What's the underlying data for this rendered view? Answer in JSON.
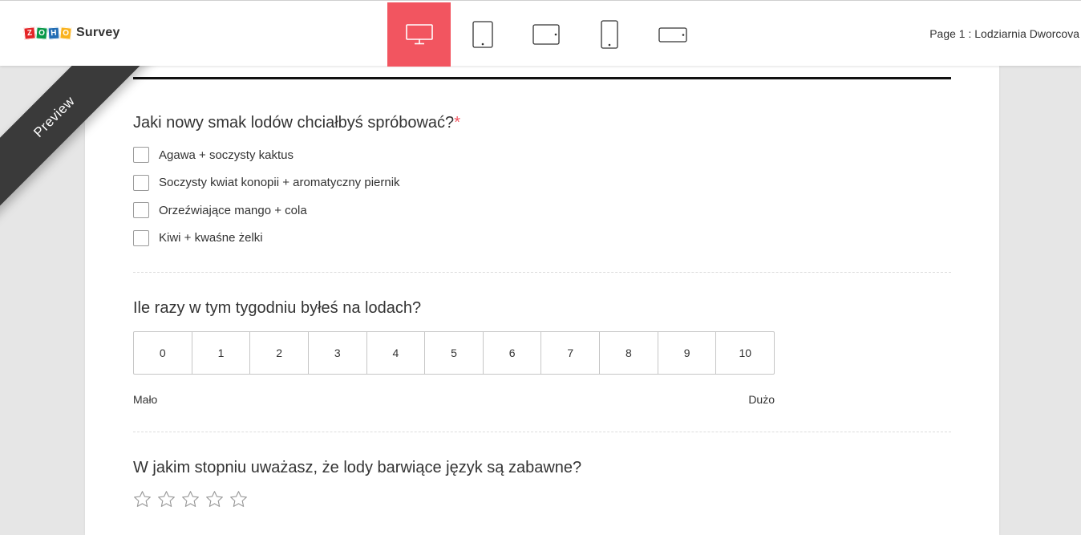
{
  "header": {
    "logo_letters": [
      "Z",
      "O",
      "H",
      "O"
    ],
    "logo_text": "Survey",
    "page_label": "Page 1 : Lodziarnia Dworcova",
    "devices": [
      {
        "name": "desktop-view",
        "icon": "monitor-icon",
        "active": true
      },
      {
        "name": "tablet-portrait-view",
        "icon": "tablet-portrait-icon",
        "active": false
      },
      {
        "name": "tablet-landscape-view",
        "icon": "tablet-landscape-icon",
        "active": false
      },
      {
        "name": "phone-portrait-view",
        "icon": "phone-portrait-icon",
        "active": false
      },
      {
        "name": "phone-landscape-view",
        "icon": "phone-landscape-icon",
        "active": false
      }
    ]
  },
  "ribbon": {
    "label": "Preview"
  },
  "q1": {
    "title": "Jaki nowy smak lodów chciałbyś spróbować?",
    "required_mark": "*",
    "options": [
      "Agawa + soczysty kaktus",
      "Soczysty kwiat konopii + aromatyczny piernik",
      "Orzeźwiające mango + cola",
      "Kiwi + kwaśne żelki"
    ]
  },
  "q2": {
    "title": "Ile razy w tym tygodniu byłeś na lodach?",
    "scale": [
      "0",
      "1",
      "2",
      "3",
      "4",
      "5",
      "6",
      "7",
      "8",
      "9",
      "10"
    ],
    "min_label": "Mało",
    "max_label": "Dużo"
  },
  "q3": {
    "title": "W jakim stopniu uważasz, że lody barwiące język są zabawne?",
    "star_count": 5,
    "rating": 0
  },
  "colors": {
    "accent": "#f25560",
    "ribbon": "#3a3a3a",
    "background": "#e6e6e6"
  }
}
